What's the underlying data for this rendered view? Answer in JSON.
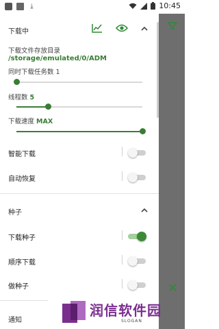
{
  "status_bar": {
    "time": "10:45",
    "left_icons": [
      "notification-icon",
      "image-icon",
      "download-icon"
    ],
    "right_icons": [
      "wifi-icon",
      "signal-icon",
      "battery-icon"
    ]
  },
  "download_section": {
    "title": "下载中",
    "dir_label": "下载文件存放目录",
    "dir_value": "/storage/emulated/0/ADM",
    "concurrent_label": "同时下载任务数",
    "concurrent_value": "1",
    "concurrent_level": 0.0,
    "threads_label": "线程数",
    "threads_value": "5",
    "threads_level": 0.25,
    "speed_label": "下载速度",
    "speed_value": "MAX",
    "speed_level": 1.0,
    "smart_label": "智能下载",
    "smart_on": false,
    "resume_label": "自动恢复",
    "resume_on": false
  },
  "seed_section": {
    "title": "种子",
    "download_seed_label": "下载种子",
    "download_seed_on": true,
    "sequential_label": "顺序下载",
    "sequential_on": false,
    "seeding_label": "做种子",
    "seeding_on": false
  },
  "notify_section": {
    "title": "通知"
  },
  "colors": {
    "accent": "#3a7d36",
    "overlay": "#6e6e6e",
    "watermark": "#7a2f8f"
  },
  "watermark": {
    "title": "润信软件园",
    "slogan": "SLOGAN"
  }
}
